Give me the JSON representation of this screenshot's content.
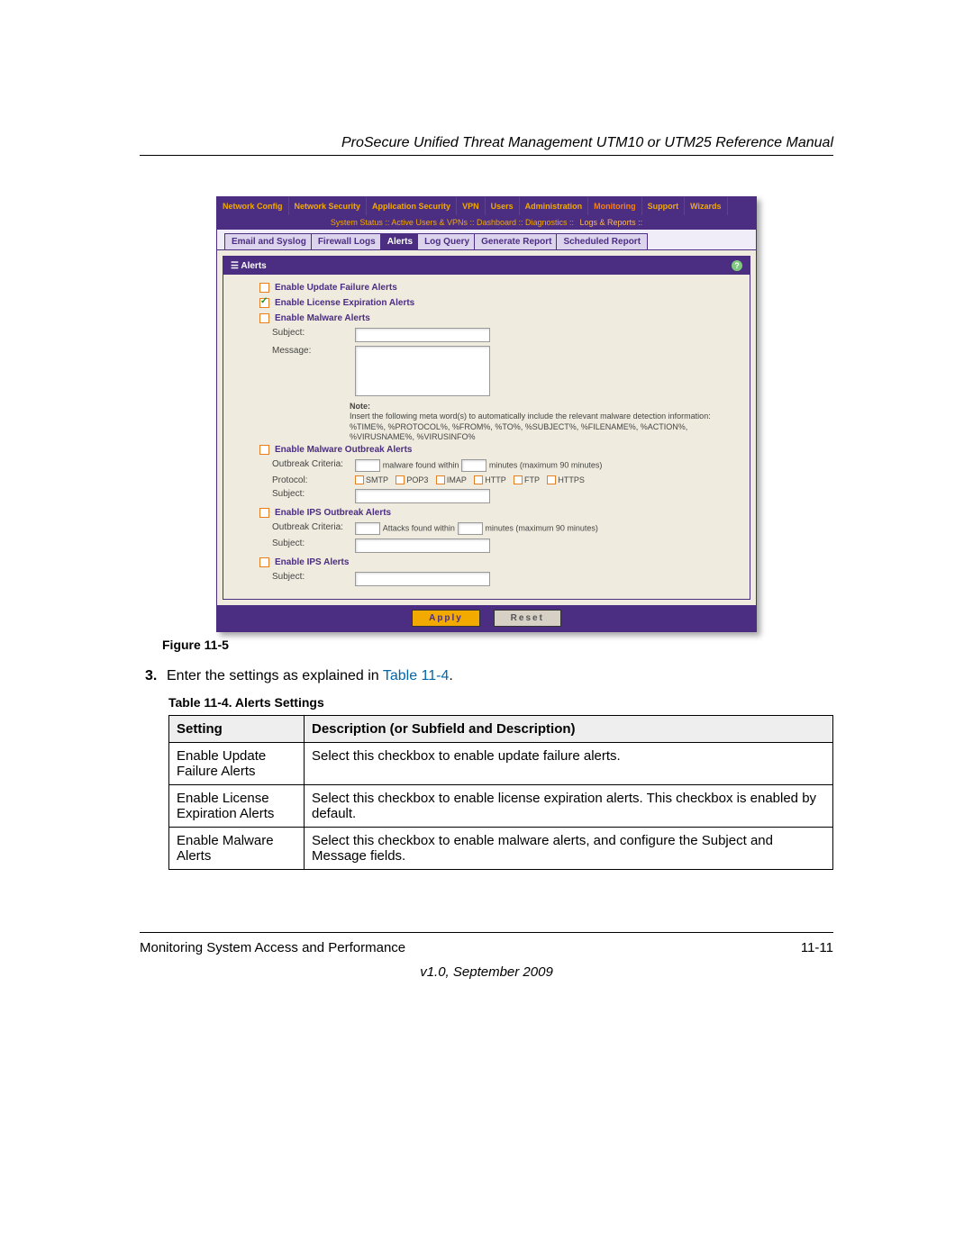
{
  "doc": {
    "title": "ProSecure Unified Threat Management UTM10 or UTM25 Reference Manual",
    "footer_left": "Monitoring System Access and Performance",
    "footer_right": "11-11",
    "version": "v1.0, September 2009"
  },
  "shot": {
    "topnav": [
      "Network Config",
      "Network Security",
      "Application Security",
      "VPN",
      "Users",
      "Administration",
      "Monitoring",
      "Support",
      "Wizards"
    ],
    "topnav_active": "Monitoring",
    "subnav_left": "System Status :: Active Users & VPNs :: Dashboard :: Diagnostics ::",
    "subnav_right": "Logs & Reports ::",
    "tabs": [
      "Email and Syslog",
      "Firewall Logs",
      "Alerts",
      "Log Query",
      "Generate Report",
      "Scheduled Report"
    ],
    "tabs_active": "Alerts",
    "section_title": "Alerts",
    "cb1": "Enable Update Failure Alerts",
    "cb2": "Enable License Expiration Alerts",
    "cb3": "Enable Malware Alerts",
    "subject_lbl": "Subject:",
    "message_lbl": "Message:",
    "note_head": "Note:",
    "note_body1": "Insert the following meta word(s) to automatically include the relevant malware detection information:",
    "note_body2": "%TIME%, %PROTOCOL%, %FROM%, %TO%, %SUBJECT%, %FILENAME%, %ACTION%, %VIRUSNAME%, %VIRUSINFO%",
    "cb4": "Enable Malware Outbreak Alerts",
    "outbreak_lbl": "Outbreak Criteria:",
    "outbreak_mid": "malware found within",
    "outbreak_tail": "minutes (maximum 90 minutes)",
    "protocol_lbl": "Protocol:",
    "protocols": [
      "SMTP",
      "POP3",
      "IMAP",
      "HTTP",
      "FTP",
      "HTTPS"
    ],
    "cb5": "Enable IPS Outbreak Alerts",
    "ips_outbreak_mid": "Attacks found within",
    "cb6": "Enable IPS Alerts",
    "apply": "Apply",
    "reset": "Reset"
  },
  "caption_fig": "Figure 11-5",
  "step": {
    "num": "3.",
    "text_a": "Enter the settings as explained in ",
    "text_link": "Table 11-4",
    "text_b": "."
  },
  "caption_tbl": "Table 11-4. Alerts Settings",
  "table": {
    "head": [
      "Setting",
      "Description (or Subfield and Description)"
    ],
    "rows": [
      [
        "Enable Update Failure Alerts",
        "Select this checkbox to enable update failure alerts."
      ],
      [
        "Enable License Expiration Alerts",
        "Select this checkbox to enable license expiration alerts. This checkbox is enabled by default."
      ],
      [
        "Enable Malware Alerts",
        "Select this checkbox to enable malware alerts, and configure the Subject and Message fields."
      ]
    ]
  }
}
